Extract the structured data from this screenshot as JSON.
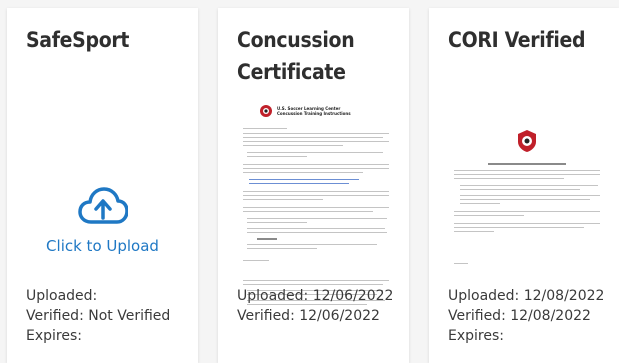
{
  "cards": [
    {
      "title": "SafeSport",
      "upload_label": "Click to Upload",
      "uploaded": "Uploaded:",
      "verified": "Verified: Not Verified",
      "expires": "Expires:"
    },
    {
      "title": "Concussion Certificate",
      "doc_heading_1": "U.S. Soccer Learning Center",
      "doc_heading_2": "Concussion Training Instructions",
      "uploaded": "Uploaded: 12/06/2022",
      "verified": "Verified: 12/06/2022"
    },
    {
      "title": "CORI Verified",
      "uploaded": "Uploaded: 12/08/2022",
      "verified": "Verified: 12/08/2022",
      "expires": "Expires:"
    }
  ],
  "colors": {
    "accent": "#1f78c4",
    "title": "#2f2f2f",
    "text": "#3a3a3a",
    "crest_red": "#c0202a"
  },
  "icons": {
    "upload": "cloud-upload-icon",
    "document_logo": "soccer-crest-icon"
  }
}
